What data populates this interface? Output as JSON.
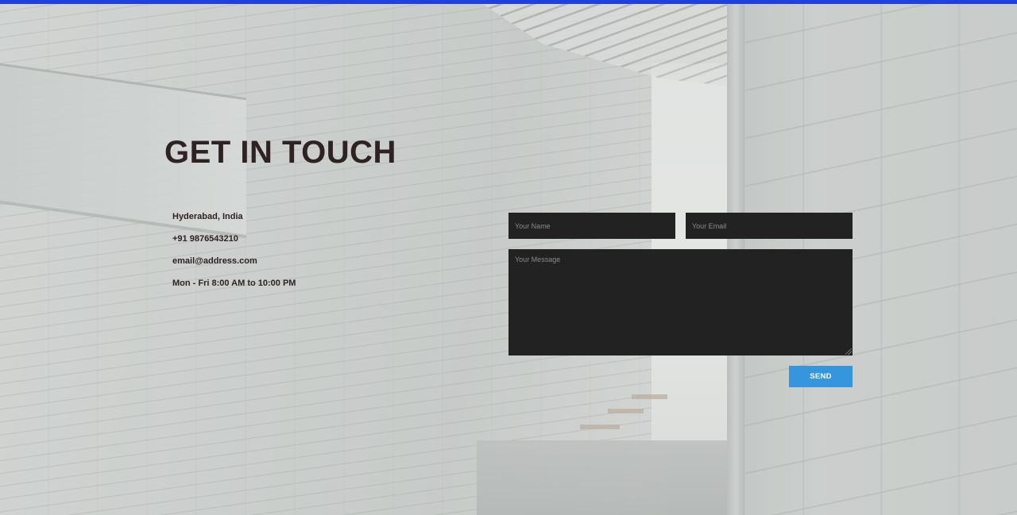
{
  "colors": {
    "accent_bar": "#1f3fe0",
    "heading_text": "#2e2222",
    "field_background": "#222222",
    "send_button": "#3596de"
  },
  "contact": {
    "heading": "GET IN TOUCH",
    "details": [
      "Hyderabad, India",
      "+91 9876543210",
      "email@address.com",
      "Mon - Fri 8:00 AM to 10:00 PM"
    ]
  },
  "form": {
    "name_placeholder": "Your Name",
    "email_placeholder": "Your Email",
    "message_placeholder": "Your Message",
    "send_label": "SEND"
  }
}
